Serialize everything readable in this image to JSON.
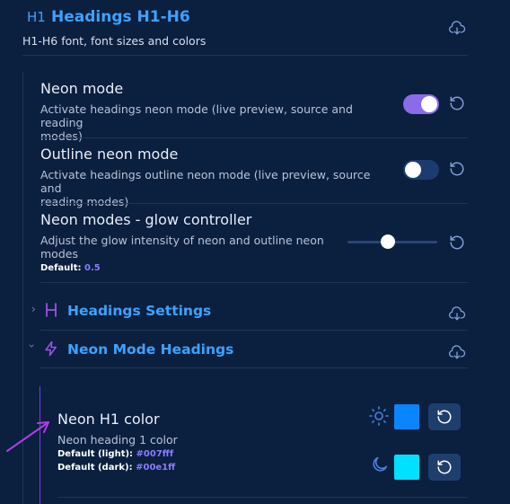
{
  "section": {
    "title": "Headings H1-H6",
    "description": "H1-H6 font, font sizes and colors",
    "h_icon_text": "H1"
  },
  "settings": [
    {
      "name": "Neon mode",
      "desc": "Activate headings neon mode (live preview, source and reading modes)",
      "desc_lines": [
        "Activate headings neon mode (live preview, source and reading",
        "modes)"
      ],
      "toggle": true
    },
    {
      "name": "Outline neon mode",
      "desc_lines": [
        "Activate headings outline neon mode (live preview, source and",
        "reading modes)"
      ],
      "toggle": false
    },
    {
      "name": "Neon modes - glow controller",
      "desc_lines": [
        "Adjust the glow intensity of neon and outline neon",
        "modes"
      ],
      "default_label": "Default: ",
      "default_value": "0.5",
      "slider_value": 0.5
    }
  ],
  "subsections": [
    {
      "title": "Headings Settings",
      "icon": "heading-icon"
    },
    {
      "title": "Neon Mode Headings",
      "icon": "lightning-icon"
    }
  ],
  "neon_h1": {
    "name": "Neon H1 color",
    "desc": "Neon heading 1 color",
    "default_light_label": "Default (light): ",
    "default_light_value": "#007fff",
    "default_dark_label": "Default (dark): ",
    "default_dark_value": "#00e1ff",
    "light_swatch": "#0a84ff",
    "dark_swatch": "#00e1ff"
  },
  "colors": {
    "background": "#0b1f3f",
    "accent_blue": "#3da2ff",
    "toggle_on": "#8b6bea",
    "toggle_off": "#1c3c70",
    "purple_line": "#7c3aed",
    "arrow": "#b33be8"
  }
}
